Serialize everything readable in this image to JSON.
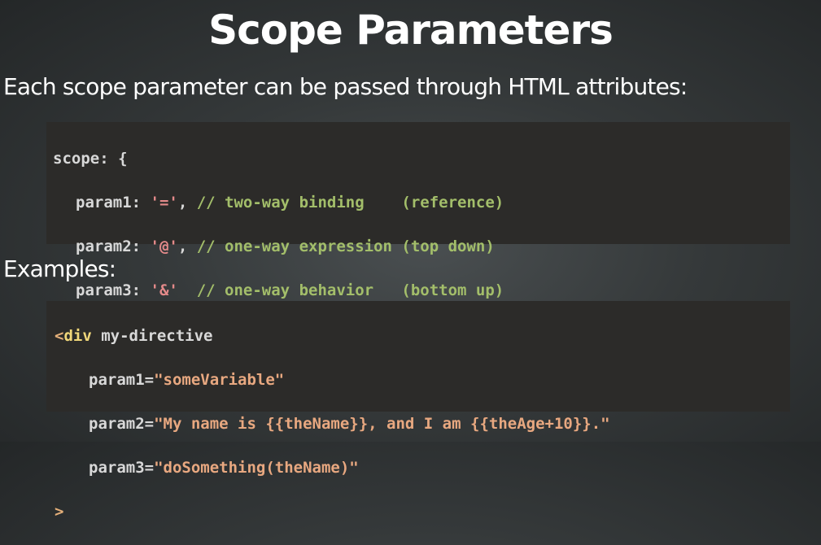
{
  "slide": {
    "title": "Scope Parameters",
    "intro": "Each scope parameter can be passed through HTML attributes:",
    "examples_label": "Examples:"
  },
  "code1": {
    "line1": "scope: {",
    "p1_key": "param1: ",
    "p1_val": "'='",
    "p1_sep": ", ",
    "p1_comment": "// two-way binding    (reference)",
    "p2_key": "param2: ",
    "p2_val": "'@'",
    "p2_sep": ", ",
    "p2_comment": "// one-way expression (top down)",
    "p3_key": "param3: ",
    "p3_val": "'&'",
    "p3_sep": "  ",
    "p3_comment": "// one-way behavior   (bottom up)",
    "close": "}"
  },
  "code2": {
    "open_lt": "<",
    "open_tag": "div",
    "open_rest": " my-directive",
    "a1_name": "param1=",
    "a1_val": "\"someVariable\"",
    "a2_name": "param2=",
    "a2_val": "\"My name is {{theName}}, and I am {{theAge+10}}.\"",
    "a3_name": "param3=",
    "a3_val": "\"doSomething(theName)\"",
    "close": ">"
  },
  "colors": {
    "background": "#35393a",
    "code_bg": "#2c2b29",
    "string": "#e48a8a",
    "comment": "#a3be6a",
    "tag": "#f0d77a"
  }
}
